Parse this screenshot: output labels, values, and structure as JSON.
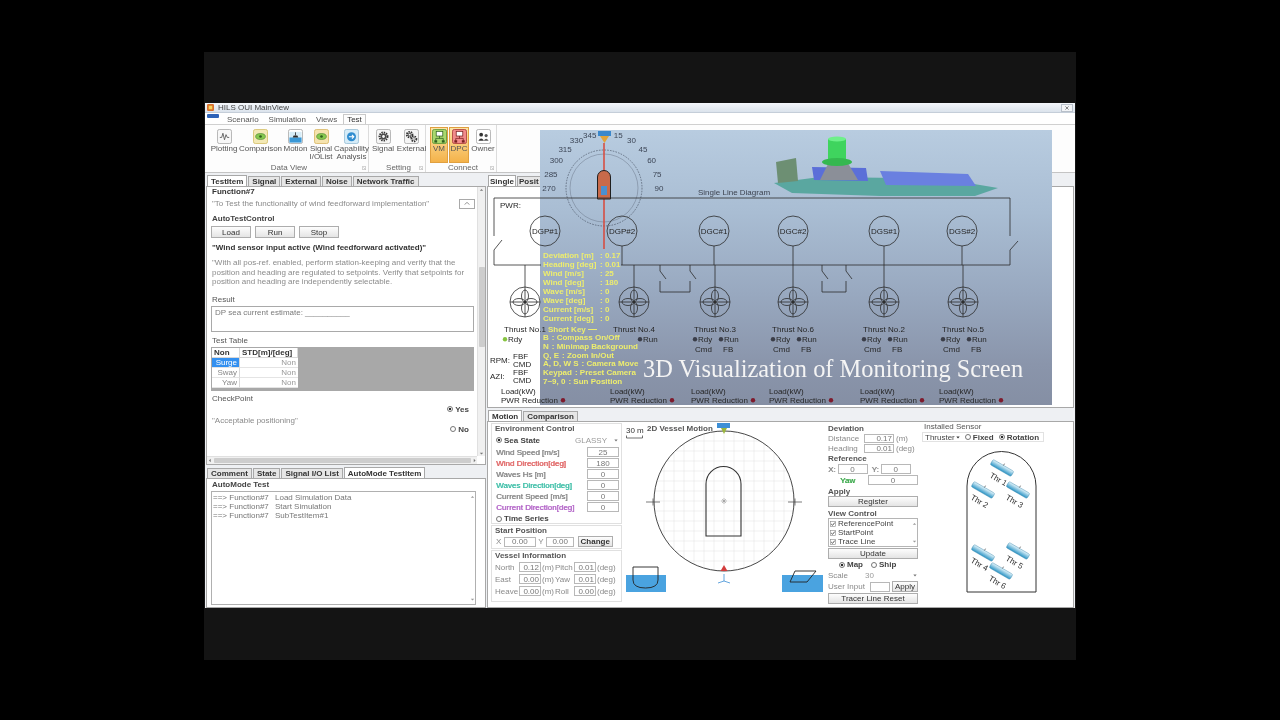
{
  "window": {
    "title": "HILS OUI MainView"
  },
  "ribbon": {
    "tabs": [
      {
        "label": "Scenario",
        "selected": false
      },
      {
        "label": "Simulation",
        "selected": false
      },
      {
        "label": "Views",
        "selected": false
      },
      {
        "label": "Test",
        "selected": true
      }
    ],
    "groups": [
      {
        "label": "Data View",
        "buttons": [
          {
            "label": "Plotting",
            "active": false
          },
          {
            "label": "Comparison",
            "active": false
          },
          {
            "label": "Motion",
            "active": false
          },
          {
            "label": "Signal I/OList",
            "active": false
          },
          {
            "label": "Capability Analysis",
            "active": false
          }
        ]
      },
      {
        "label": "Setting",
        "buttons": [
          {
            "label": "Signal",
            "active": false
          },
          {
            "label": "External",
            "active": false
          }
        ]
      },
      {
        "label": "Connect",
        "buttons": [
          {
            "label": "VM",
            "active": true
          },
          {
            "label": "DPC",
            "active": true
          },
          {
            "label": "Owner",
            "active": false
          }
        ]
      }
    ]
  },
  "test_panel": {
    "tabs": [
      {
        "label": "TestItem",
        "selected": true
      },
      {
        "label": "Signal",
        "selected": false
      },
      {
        "label": "External",
        "selected": false
      },
      {
        "label": "Noise",
        "selected": false
      },
      {
        "label": "Network Traffic",
        "selected": false
      }
    ],
    "function": "Function#7",
    "description": "\"To Test the functionality of wind feedforward implementation\"",
    "auto_test_control": {
      "title": "AutoTestControl",
      "buttons": [
        "Load",
        "Run",
        "Stop"
      ]
    },
    "condition": "\"Wind sensor input active (Wind feedforward activated)\"",
    "procedure": "\"With all pos-ref. enabled, perform station-keeping and verify that the position and heading are regulated to setpoints. Verify that setpoints for position and heading are independently selectable.",
    "result": {
      "title": "Result",
      "value": "DP sea current estimate: __________"
    },
    "test_table": {
      "title": "Test Table",
      "columns": [
        "Non",
        "STD[m]/[deg]"
      ],
      "rows": [
        {
          "name": "Surge",
          "value": "Non",
          "selected": true
        },
        {
          "name": "Sway",
          "value": "Non",
          "selected": false
        },
        {
          "name": "Yaw",
          "value": "Non",
          "selected": false
        }
      ]
    },
    "checkpoint": {
      "title": "CheckPoint",
      "text": "\"Acceptable positioning\"",
      "options": [
        {
          "label": "Yes",
          "selected": true
        },
        {
          "label": "No",
          "selected": false
        }
      ]
    }
  },
  "automode_panel": {
    "tabs": [
      {
        "label": "Comment",
        "selected": false
      },
      {
        "label": "State",
        "selected": false
      },
      {
        "label": "Signal I/O List",
        "selected": false
      },
      {
        "label": "AutoMode TestItem",
        "selected": true
      }
    ],
    "title": "AutoMode Test",
    "entries": [
      {
        "function": "==> Function#7",
        "step": "Load Simulation Data"
      },
      {
        "function": "==> Function#7",
        "step": "Start Simulation"
      },
      {
        "function": "==> Function#7",
        "step": "SubTestItem#1"
      }
    ]
  },
  "diagram_panel": {
    "tabs": [
      {
        "label": "Single",
        "selected": true
      },
      {
        "label": "Posit",
        "selected": false
      }
    ],
    "title": "Single Line Diagram",
    "bus_label": "PWR:",
    "breakers": [
      {
        "closed": false
      },
      {
        "closed": false
      }
    ],
    "bus_ties": [
      {
        "closed": false
      },
      {
        "closed": false
      }
    ],
    "generators": [
      "DGP#1",
      "DGP#2",
      "DGC#1",
      "DGC#2",
      "DGS#1",
      "DGS#2"
    ],
    "thrusters": [
      {
        "name": "Thrust No.1",
        "lamps": [
          {
            "kind": "ready",
            "label": "Rdy",
            "color": "#86c440"
          }
        ],
        "load": "Load(kW)",
        "reduction": {
          "label": "PWR Reduction",
          "color": "#7e1a2c"
        }
      },
      {
        "name": "Thrust No.4",
        "lamps": [
          {
            "kind": "run",
            "label": "Run",
            "color": "#3a3d48"
          }
        ],
        "load": "Load(kW)",
        "reduction": {
          "label": "PWR Reduction",
          "color": "#7e1a2c"
        }
      },
      {
        "name": "Thrust No.3",
        "lamps": [
          {
            "kind": "ready",
            "label": "Rdy",
            "color": "#3a3d48"
          },
          {
            "kind": "run",
            "label": "Run",
            "color": "#3a3d48"
          }
        ],
        "columns": [
          {
            "kind": "command",
            "label": "Cmd"
          },
          {
            "kind": "feedback",
            "label": "FB"
          }
        ],
        "load": "Load(kW)",
        "reduction": {
          "label": "PWR Reduction",
          "color": "#7e1a2c"
        }
      },
      {
        "name": "Thrust No.6",
        "lamps": [
          {
            "kind": "ready",
            "label": "Rdy",
            "color": "#3a3d48"
          },
          {
            "kind": "run",
            "label": "Run",
            "color": "#3a3d48"
          }
        ],
        "columns": [
          {
            "kind": "command",
            "label": "Cmd"
          },
          {
            "kind": "feedback",
            "label": "FB"
          }
        ],
        "load": "Load(kW)",
        "reduction": {
          "label": "PWR Reduction",
          "color": "#7e1a2c"
        }
      },
      {
        "name": "Thrust No.2",
        "lamps": [
          {
            "kind": "ready",
            "label": "Rdy",
            "color": "#3a3d48"
          },
          {
            "kind": "run",
            "label": "Run",
            "color": "#3a3d48"
          }
        ],
        "columns": [
          {
            "kind": "command",
            "label": "Cmd"
          },
          {
            "kind": "feedback",
            "label": "FB"
          }
        ],
        "load": "Load(kW)",
        "reduction": {
          "label": "PWR Reduction",
          "color": "#7e1a2c"
        }
      },
      {
        "name": "Thrust No.5",
        "lamps": [
          {
            "kind": "ready",
            "label": "Rdy",
            "color": "#3a3d48"
          },
          {
            "kind": "run",
            "label": "Run",
            "color": "#3a3d48"
          }
        ],
        "columns": [
          {
            "kind": "command",
            "label": "Cmd"
          },
          {
            "kind": "feedback",
            "label": "FB"
          }
        ],
        "load": "Load(kW)",
        "reduction": {
          "label": "PWR Reduction",
          "color": "#7e1a2c"
        }
      }
    ],
    "signal_rows": [
      {
        "label": "RPM:",
        "signals": [
          "FBF",
          "CMD"
        ]
      },
      {
        "label": "AZI:",
        "signals": [
          "FBF",
          "CMD"
        ]
      }
    ]
  },
  "visualization": {
    "compass_labels": [
      "270",
      "285",
      "300",
      "315",
      "330",
      "345",
      "15",
      "30",
      "45",
      "60",
      "75",
      "90"
    ],
    "readouts": [
      {
        "label": "Deviation [m]",
        "value": ": 0.17"
      },
      {
        "label": "Heading [deg]",
        "value": ": 0.01"
      },
      {
        "label": "Wind [m/s]",
        "value": ": 25"
      },
      {
        "label": "Wind [deg]",
        "value": ": 180"
      },
      {
        "label": "Wave [m/s]",
        "value": ": 0"
      },
      {
        "label": "Wave [deg]",
        "value": ": 0"
      },
      {
        "label": "Current [m/s]",
        "value": ": 0"
      },
      {
        "label": "Current [deg]",
        "value": ": 0"
      }
    ],
    "short_key_title": "Short Key",
    "short_keys": [
      {
        "key": "B",
        "action": ": Compass On/Off"
      },
      {
        "key": "N",
        "action": ": Minimap Background"
      },
      {
        "key": "Q, E",
        "action": ": Zoom In/Out"
      },
      {
        "key": "A, D, W S",
        "action": ": Camera Move"
      },
      {
        "key": "Keypad",
        "action": ": Preset Camera"
      },
      {
        "key": "7~9, 0",
        "action": ": Sun Position"
      }
    ],
    "caption": "3D Visualization of Monitoring Screen"
  },
  "motion_panel": {
    "tabs": [
      {
        "label": "Motion",
        "selected": true
      },
      {
        "label": "Comparison",
        "selected": false
      }
    ],
    "environment": {
      "title": "Environment Control",
      "modes": [
        {
          "label": "Sea State",
          "selected": true
        },
        {
          "label": "Time Series",
          "selected": false
        }
      ],
      "sea_state": "GLASSY",
      "fields": [
        {
          "label": "Wind Speed [m/s]",
          "value": "25",
          "color": "#8a8a8a"
        },
        {
          "label": "Wind Direction[deg]",
          "value": "180",
          "color": "#e06666"
        },
        {
          "label": "Waves Hs [m]",
          "value": "0",
          "color": "#8a8a8a"
        },
        {
          "label": "Waves Direction[deg]",
          "value": "0",
          "color": "#3fbfa8"
        },
        {
          "label": "Current Speed [m/s]",
          "value": "0",
          "color": "#8a8a8a"
        },
        {
          "label": "Current Direction[deg]",
          "value": "0",
          "color": "#b365c8"
        }
      ]
    },
    "start_position": {
      "title": "Start Position",
      "fields": [
        {
          "label": "X",
          "value": "0.00"
        },
        {
          "label": "Y",
          "value": "0.00"
        }
      ],
      "button": "Change"
    },
    "vessel_info": {
      "title": "Vessel Information",
      "fields": [
        {
          "label": "North",
          "value": "0.12",
          "unit": "(m)"
        },
        {
          "label": "Pitch",
          "value": "0.01",
          "unit": "(deg)"
        },
        {
          "label": "East",
          "value": "0.00",
          "unit": "(m)"
        },
        {
          "label": "Yaw",
          "value": "0.01",
          "unit": "(deg)"
        },
        {
          "label": "Heave",
          "value": "0.00",
          "unit": "(m)"
        },
        {
          "label": "Roll",
          "value": "0.00",
          "unit": "(deg)"
        }
      ]
    },
    "vessel_motion": {
      "title": "2D Vessel Motion",
      "scale": "30 m"
    },
    "deviation": {
      "title": "Deviation",
      "fields": [
        {
          "label": "Distance",
          "value": "0.17",
          "unit": "(m)"
        },
        {
          "label": "Heading",
          "value": "0.01",
          "unit": "(deg)"
        }
      ]
    },
    "reference": {
      "title": "Reference",
      "fields": [
        {
          "label": "X:",
          "value": "0",
          "color": "#8a8a8a"
        },
        {
          "label": "Y:",
          "value": "0",
          "color": "#8a8a8a"
        },
        {
          "label": "Yaw",
          "value": "0",
          "color": "#3aa84a"
        }
      ]
    },
    "apply": {
      "title": "Apply",
      "button": "Register"
    },
    "view_control": {
      "title": "View Control",
      "items": [
        {
          "label": "ReferencePoint",
          "checked": true
        },
        {
          "label": "StartPoint",
          "checked": true
        },
        {
          "label": "Trace Line",
          "checked": true
        }
      ],
      "button": "Update",
      "views": [
        {
          "label": "Map",
          "selected": true
        },
        {
          "label": "Ship",
          "selected": false
        }
      ],
      "scale_label": "Scale",
      "scale": "30",
      "user_input_label": "User Input",
      "apply_button": "Apply",
      "reset_button": "Tracer Line Reset"
    },
    "installed_sensor": {
      "title": "Installed Sensor",
      "device": "Thruster",
      "modes": [
        {
          "label": "Fixed",
          "selected": false
        },
        {
          "label": "Rotation",
          "selected": true
        }
      ],
      "thrusters": [
        "Thr 1",
        "Thr 2",
        "Thr 3",
        "Thr 4",
        "Thr 5",
        "Thr 6"
      ]
    }
  }
}
